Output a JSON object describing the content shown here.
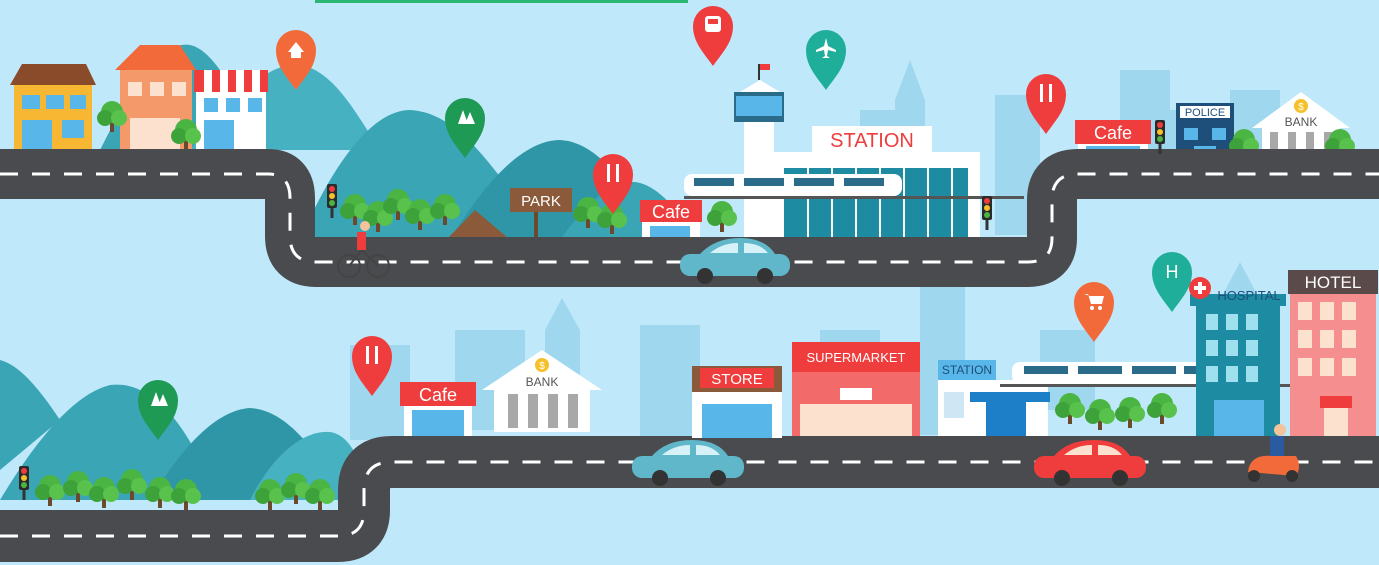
{
  "labels": {
    "park": "PARK",
    "cafe_top_mid": "Cafe",
    "station_top": "STATION",
    "cafe_top_right": "Cafe",
    "police": "POLICE",
    "bank_top": "BANK",
    "hospital": "HOSPITAL",
    "hotel": "HOTEL",
    "cafe_bottom": "Cafe",
    "bank_bottom": "BANK",
    "store": "STORE",
    "supermarket": "SUPERMARKET",
    "station_bottom": "STATION",
    "hospital_pin": "H",
    "bank_symbol": "$"
  },
  "pins": [
    {
      "name": "home-pin",
      "icon": "home-icon",
      "color": "#f26a3a"
    },
    {
      "name": "park-pin-top",
      "icon": "trees-icon",
      "color": "#1f9a55"
    },
    {
      "name": "restaurant-pin-top",
      "icon": "fork-knife-icon",
      "color": "#ef3c3c"
    },
    {
      "name": "train-pin",
      "icon": "train-icon",
      "color": "#ef3c3c"
    },
    {
      "name": "airport-pin",
      "icon": "airplane-icon",
      "color": "#1fae9a"
    },
    {
      "name": "restaurant-pin-right",
      "icon": "fork-knife-icon",
      "color": "#ef3c3c"
    },
    {
      "name": "hospital-pin",
      "icon": "h-icon",
      "color": "#1fae9a"
    },
    {
      "name": "shopping-pin",
      "icon": "cart-icon",
      "color": "#f26a3a"
    },
    {
      "name": "restaurant-pin-bottom",
      "icon": "fork-knife-icon",
      "color": "#ef3c3c"
    },
    {
      "name": "park-pin-bottom",
      "icon": "trees-icon",
      "color": "#1f9a55"
    }
  ],
  "colors": {
    "sky": "#bfe9fb",
    "road": "#4a4b4f",
    "mountain": "#3aa5b5",
    "tree": "#4bb543",
    "red": "#ef3c3c",
    "teal": "#1fae9a",
    "skyline": "#9fd8ee"
  }
}
